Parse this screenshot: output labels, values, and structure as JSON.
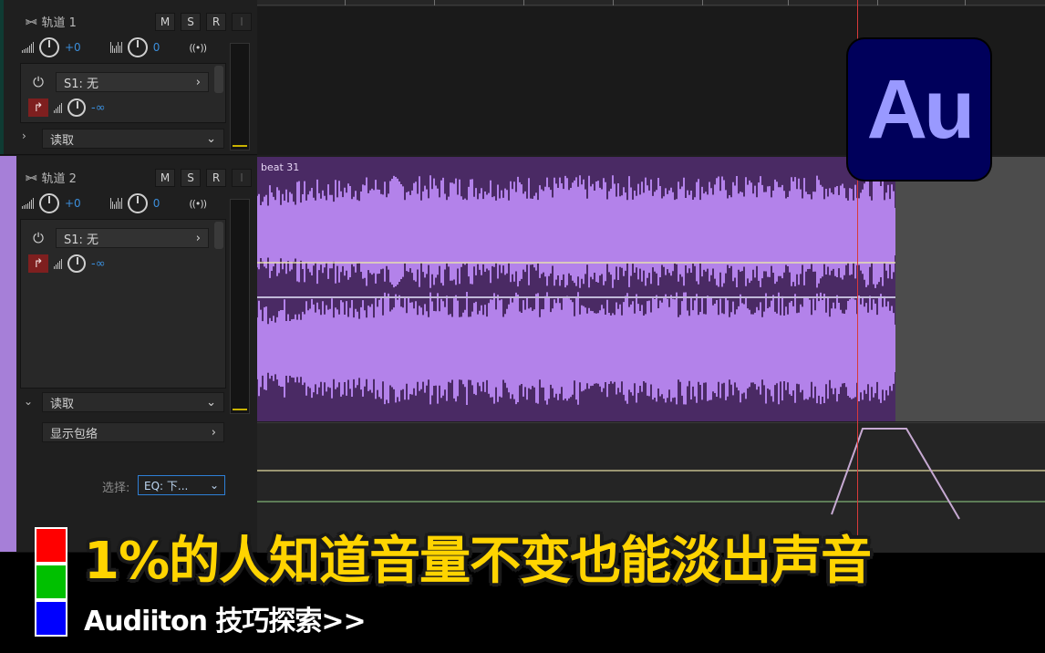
{
  "track1": {
    "name": "轨道 1",
    "mute": "M",
    "solo": "S",
    "record": "R",
    "input": "I",
    "volume": "+0",
    "pan": "0",
    "fx_slot": "S1: 无",
    "send_value": "-∞",
    "automation_mode": "读取"
  },
  "track2": {
    "name": "轨道 2",
    "mute": "M",
    "solo": "S",
    "record": "R",
    "input": "I",
    "volume": "+0",
    "pan": "0",
    "fx_slot": "S1: 无",
    "send_value": "-∞",
    "automation_mode": "读取",
    "show_envelopes": "显示包络",
    "select_label": "选择:",
    "select_value": "EQ: 下..."
  },
  "clip": {
    "name": "beat 31",
    "color": "#b382ea"
  },
  "logo": {
    "text": "Au",
    "bg": "#00005b",
    "fg": "#9999ff"
  },
  "overlay": {
    "title": "1%的人知道音量不变也能淡出声音",
    "subtitle": "Audiiton 技巧探索>>",
    "title_color": "#ffd400"
  },
  "icons": {
    "wave": "waveform-icon",
    "power": "power-icon",
    "send": "send-icon",
    "chevron": "chevron-icon",
    "balance": "stereo-balance-icon"
  }
}
